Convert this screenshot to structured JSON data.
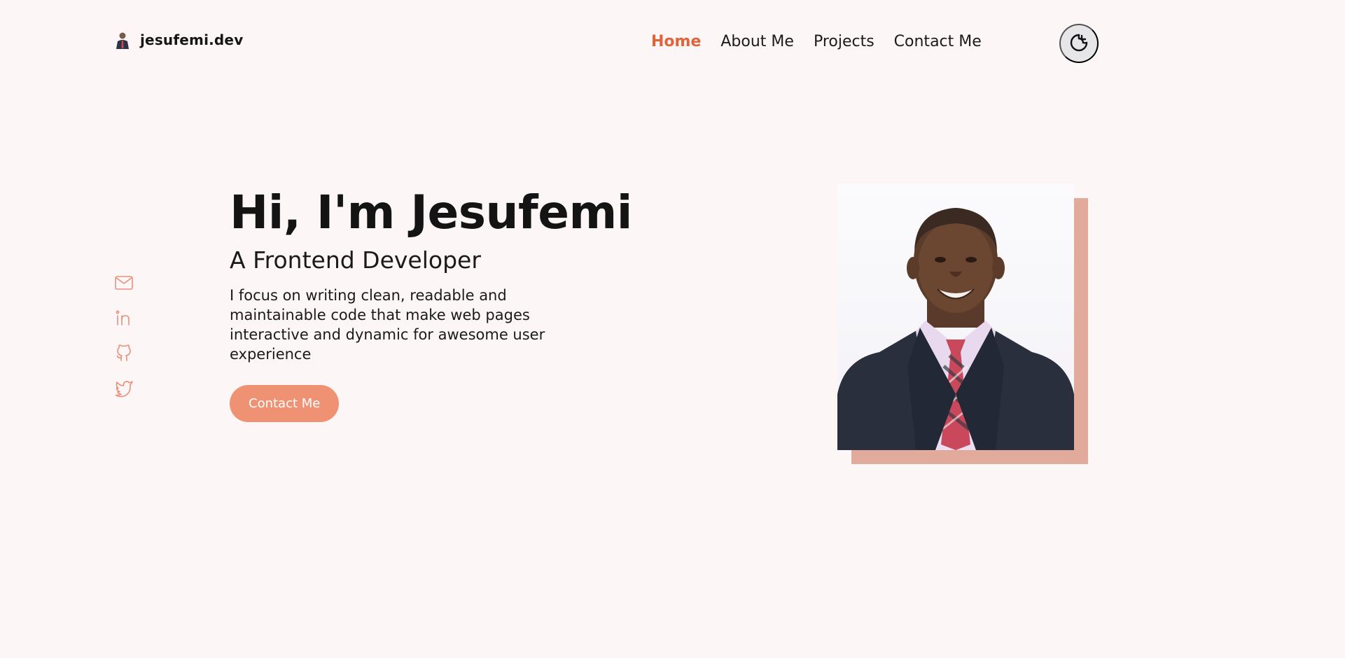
{
  "header": {
    "logo_text": "jesufemi.dev",
    "nav": [
      {
        "label": "Home",
        "active": true
      },
      {
        "label": "About Me",
        "active": false
      },
      {
        "label": "Projects",
        "active": false
      },
      {
        "label": "Contact Me",
        "active": false
      }
    ],
    "theme_toggle_icon": "moon-icon"
  },
  "socials": [
    {
      "icon": "mail-icon"
    },
    {
      "icon": "linkedin-icon"
    },
    {
      "icon": "github-icon"
    },
    {
      "icon": "twitter-icon"
    }
  ],
  "hero": {
    "title": "Hi, I'm Jesufemi",
    "subtitle": "A Frontend Developer",
    "description": "I focus on writing clean, readable and maintainable code that make web pages interactive and dynamic for awesome user experience",
    "cta_label": "Contact Me"
  },
  "colors": {
    "accent": "#e0643b",
    "button": "#ef9274",
    "photo_frame": "#e2aa9a",
    "background": "#fdf6f6",
    "social_icons": "#e8917a"
  }
}
